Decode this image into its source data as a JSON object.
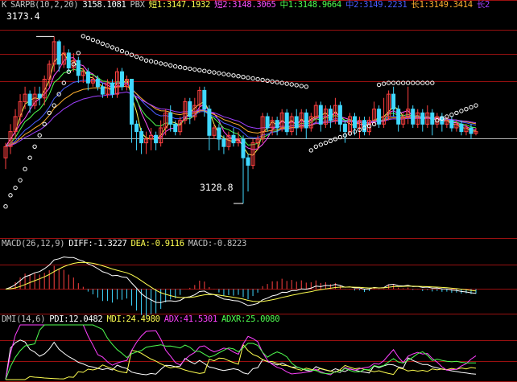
{
  "colors": {
    "background": "#000000",
    "grid": "#9a1010",
    "up": "#ff4040",
    "down": "#40d8ff",
    "sar": "#ffffff",
    "ma_short1": "#ffff50",
    "ma_short2": "#ff50ff",
    "ma_mid1": "#50ff50",
    "ma_mid2": "#4a5cff",
    "ma_long1": "#ffb030",
    "ma_long2": "#a040ff",
    "diff": "#ffffff",
    "dea": "#ffff50",
    "pdi": "#ffffff",
    "mdi": "#ffff50",
    "adx": "#ff40ff",
    "adxr": "#50ff50",
    "label_gray": "#c0c0c0"
  },
  "price_panel": {
    "header": [
      {
        "text": "K",
        "color": "#c0c0c0"
      },
      {
        "text": "SARPB(10,2,20)",
        "color": "#c0c0c0"
      },
      {
        "text": "3158.1081",
        "color": "#ffffff"
      },
      {
        "text": "PBX",
        "color": "#c0c0c0"
      },
      {
        "text": "短1:3147.1932",
        "color": "#ffff50"
      },
      {
        "text": "短2:3148.3065",
        "color": "#ff50ff"
      },
      {
        "text": "中1:3148.9664",
        "color": "#50ff50"
      },
      {
        "text": "中2:3149.2231",
        "color": "#4a5cff"
      },
      {
        "text": "长1:3149.3414",
        "color": "#ffb030"
      },
      {
        "text": "长2",
        "color": "#a040ff"
      }
    ],
    "high_label": "3173.4",
    "low_label": "3128.8",
    "high_value": 3173.4,
    "low_value": 3128.8
  },
  "macd_panel": {
    "header": [
      {
        "text": "MACD(26,12,9)",
        "color": "#c0c0c0"
      },
      {
        "text": "DIFF:-1.3227",
        "color": "#ffffff"
      },
      {
        "text": "DEA:-0.9116",
        "color": "#ffff50"
      },
      {
        "text": "MACD:-0.8223",
        "color": "#c0c0c0"
      }
    ]
  },
  "dmi_panel": {
    "header": [
      {
        "text": "DMI(14,6)",
        "color": "#c0c0c0"
      },
      {
        "text": "PDI:12.0482",
        "color": "#ffffff"
      },
      {
        "text": "MDI:24.4980",
        "color": "#ffff50"
      },
      {
        "text": "ADX:41.5301",
        "color": "#ff40ff"
      },
      {
        "text": "ADXR:25.0080",
        "color": "#50ff50"
      }
    ]
  },
  "chart_data": {
    "type": "candlestick",
    "price_range": [
      3123.0,
      3178.0
    ],
    "candles": [
      [
        3141.0,
        3144.0,
        3138.0,
        3145.0
      ],
      [
        3144.0,
        3148.0,
        3142.0,
        3150.0
      ],
      [
        3148.0,
        3152.0,
        3146.0,
        3154.0
      ],
      [
        3152.0,
        3156.0,
        3150.0,
        3158.0
      ],
      [
        3156.0,
        3158.0,
        3154.0,
        3160.0
      ],
      [
        3158.0,
        3155.0,
        3153.0,
        3159.0
      ],
      [
        3155.0,
        3158.0,
        3154.0,
        3160.0
      ],
      [
        3158.0,
        3157.0,
        3155.0,
        3160.0
      ],
      [
        3157.0,
        3162.0,
        3155.0,
        3163.0
      ],
      [
        3162.0,
        3166.0,
        3160.0,
        3167.0
      ],
      [
        3166.0,
        3172.0,
        3164.0,
        3173.4
      ],
      [
        3172.0,
        3166.0,
        3164.0,
        3172.5
      ],
      [
        3166.0,
        3169.0,
        3165.0,
        3171.0
      ],
      [
        3169.0,
        3165.0,
        3164.0,
        3170.0
      ],
      [
        3165.0,
        3167.0,
        3164.0,
        3169.0
      ],
      [
        3167.0,
        3163.0,
        3161.0,
        3168.0
      ],
      [
        3163.0,
        3164.0,
        3161.0,
        3165.0
      ],
      [
        3164.0,
        3161.0,
        3159.0,
        3165.0
      ],
      [
        3161.0,
        3162.0,
        3160.0,
        3163.0
      ],
      [
        3162.0,
        3160.0,
        3159.0,
        3163.0
      ],
      [
        3160.0,
        3158.0,
        3157.0,
        3161.0
      ],
      [
        3158.0,
        3161.0,
        3157.0,
        3162.0
      ],
      [
        3161.0,
        3158.0,
        3157.0,
        3162.0
      ],
      [
        3158.0,
        3164.0,
        3157.0,
        3165.0
      ],
      [
        3164.0,
        3160.0,
        3159.0,
        3165.0
      ],
      [
        3160.0,
        3162.0,
        3159.0,
        3163.0
      ],
      [
        3162.0,
        3150.0,
        3145.0,
        3161.0
      ],
      [
        3150.0,
        3148.0,
        3143.0,
        3151.0
      ],
      [
        3148.0,
        3145.0,
        3142.0,
        3149.0
      ],
      [
        3145.0,
        3146.0,
        3142.0,
        3148.0
      ],
      [
        3146.0,
        3147.0,
        3143.0,
        3149.0
      ],
      [
        3147.0,
        3145.0,
        3143.0,
        3148.0
      ],
      [
        3145.0,
        3149.0,
        3144.0,
        3151.0
      ],
      [
        3149.0,
        3153.0,
        3147.0,
        3154.0
      ],
      [
        3153.0,
        3150.0,
        3148.0,
        3155.0
      ],
      [
        3150.0,
        3148.0,
        3147.0,
        3151.0
      ],
      [
        3148.0,
        3151.0,
        3147.0,
        3152.0
      ],
      [
        3151.0,
        3156.0,
        3150.0,
        3157.0
      ],
      [
        3156.0,
        3152.0,
        3150.0,
        3157.0
      ],
      [
        3152.0,
        3155.0,
        3151.0,
        3157.0
      ],
      [
        3155.0,
        3159.0,
        3153.0,
        3160.0
      ],
      [
        3159.0,
        3154.0,
        3152.0,
        3160.0
      ],
      [
        3154.0,
        3147.0,
        3143.0,
        3155.0
      ],
      [
        3147.0,
        3149.0,
        3146.0,
        3150.0
      ],
      [
        3149.0,
        3146.0,
        3143.0,
        3150.0
      ],
      [
        3146.0,
        3144.0,
        3142.0,
        3147.0
      ],
      [
        3144.0,
        3147.0,
        3143.0,
        3148.0
      ],
      [
        3147.0,
        3145.0,
        3144.0,
        3149.0
      ],
      [
        3145.0,
        3146.0,
        3144.0,
        3148.0
      ],
      [
        3146.0,
        3141.0,
        3128.8,
        3147.0
      ],
      [
        3141.0,
        3139.0,
        3132.0,
        3142.0
      ],
      [
        3139.0,
        3145.0,
        3138.0,
        3146.0
      ],
      [
        3145.0,
        3146.0,
        3143.0,
        3147.0
      ],
      [
        3146.0,
        3152.0,
        3145.0,
        3153.0
      ],
      [
        3152.0,
        3149.0,
        3148.0,
        3153.0
      ],
      [
        3149.0,
        3151.0,
        3147.0,
        3152.0
      ],
      [
        3151.0,
        3149.0,
        3147.0,
        3152.0
      ],
      [
        3149.0,
        3153.0,
        3148.0,
        3154.0
      ],
      [
        3153.0,
        3148.0,
        3147.0,
        3154.0
      ],
      [
        3148.0,
        3152.0,
        3147.0,
        3153.0
      ],
      [
        3152.0,
        3149.0,
        3147.0,
        3154.0
      ],
      [
        3149.0,
        3153.0,
        3148.0,
        3154.0
      ],
      [
        3153.0,
        3149.0,
        3146.0,
        3154.0
      ],
      [
        3149.0,
        3152.0,
        3148.0,
        3153.0
      ],
      [
        3152.0,
        3155.0,
        3150.0,
        3156.0
      ],
      [
        3155.0,
        3150.0,
        3148.0,
        3156.0
      ],
      [
        3150.0,
        3154.0,
        3149.0,
        3155.0
      ],
      [
        3154.0,
        3151.0,
        3149.0,
        3155.0
      ],
      [
        3151.0,
        3155.0,
        3150.0,
        3157.0
      ],
      [
        3155.0,
        3150.0,
        3148.0,
        3156.0
      ],
      [
        3150.0,
        3148.0,
        3145.0,
        3151.0
      ],
      [
        3148.0,
        3152.0,
        3147.0,
        3153.0
      ],
      [
        3152.0,
        3149.0,
        3147.0,
        3153.0
      ],
      [
        3149.0,
        3151.0,
        3146.0,
        3152.0
      ],
      [
        3151.0,
        3148.0,
        3147.0,
        3152.0
      ],
      [
        3148.0,
        3151.0,
        3147.0,
        3152.0
      ],
      [
        3151.0,
        3154.0,
        3150.0,
        3156.0
      ],
      [
        3154.0,
        3150.0,
        3149.0,
        3155.0
      ],
      [
        3150.0,
        3152.0,
        3149.0,
        3157.0
      ],
      [
        3152.0,
        3158.0,
        3151.0,
        3159.0
      ],
      [
        3158.0,
        3154.0,
        3152.0,
        3160.0
      ],
      [
        3154.0,
        3150.0,
        3148.0,
        3155.0
      ],
      [
        3150.0,
        3152.0,
        3149.0,
        3153.0
      ],
      [
        3152.0,
        3154.0,
        3150.0,
        3160.0
      ],
      [
        3154.0,
        3150.0,
        3149.0,
        3155.0
      ],
      [
        3150.0,
        3153.0,
        3149.0,
        3154.0
      ],
      [
        3153.0,
        3150.0,
        3148.0,
        3154.0
      ],
      [
        3150.0,
        3153.0,
        3149.0,
        3155.0
      ],
      [
        3153.0,
        3150.0,
        3147.0,
        3154.0
      ],
      [
        3150.0,
        3152.0,
        3149.0,
        3153.0
      ],
      [
        3152.0,
        3150.0,
        3148.0,
        3153.0
      ],
      [
        3150.0,
        3151.0,
        3149.0,
        3152.0
      ],
      [
        3151.0,
        3149.0,
        3148.0,
        3152.0
      ],
      [
        3149.0,
        3150.0,
        3148.0,
        3151.0
      ],
      [
        3150.0,
        3148.0,
        3147.0,
        3151.0
      ],
      [
        3148.0,
        3149.0,
        3147.0,
        3150.0
      ],
      [
        3149.0,
        3147.5,
        3146.0,
        3150.0
      ],
      [
        3147.5,
        3148.0,
        3147.0,
        3149.0
      ]
    ],
    "sar_points": [
      3128,
      3131,
      3133,
      3135,
      3138,
      3141,
      3144,
      3147,
      3150,
      3153,
      3155,
      3158,
      3161,
      3164,
      3166,
      3169,
      3173.5,
      3173,
      3172.5,
      3172,
      3171.5,
      3171,
      3170.5,
      3170,
      3169.5,
      3169,
      3168.5,
      3168,
      3167.5,
      3167,
      3166.8,
      3166.5,
      3166.2,
      3166,
      3165.7,
      3165.4,
      3165.2,
      3165,
      3164.8,
      3164.6,
      3164.4,
      3164.2,
      3164,
      3163.8,
      3163.6,
      3163.4,
      3163.2,
      3163,
      3162.8,
      3162.6,
      3162.4,
      3162.2,
      3162,
      3161.8,
      3161.6,
      3161.4,
      3161.2,
      3161,
      3160.8,
      3160.6,
      3160.4,
      3160.2,
      3160,
      3143,
      3144,
      3144.5,
      3145,
      3145.5,
      3146,
      3146.5,
      3147,
      3147.5,
      3148,
      3148.5,
      3149,
      3149.5,
      3150,
      3160.5,
      3160.8,
      3161,
      3161,
      3161,
      3161,
      3161,
      3161,
      3161,
      3161,
      3161,
      3161,
      3151,
      3151.5,
      3152,
      3152.5,
      3153,
      3153.5,
      3154,
      3154.5,
      3155,
      3155.5,
      3156,
      3156.5
    ],
    "macd": {
      "diff_scale": 3.0,
      "macd_bar_scale": 2.0
    },
    "dmi": {
      "range": [
        0,
        60
      ]
    }
  }
}
